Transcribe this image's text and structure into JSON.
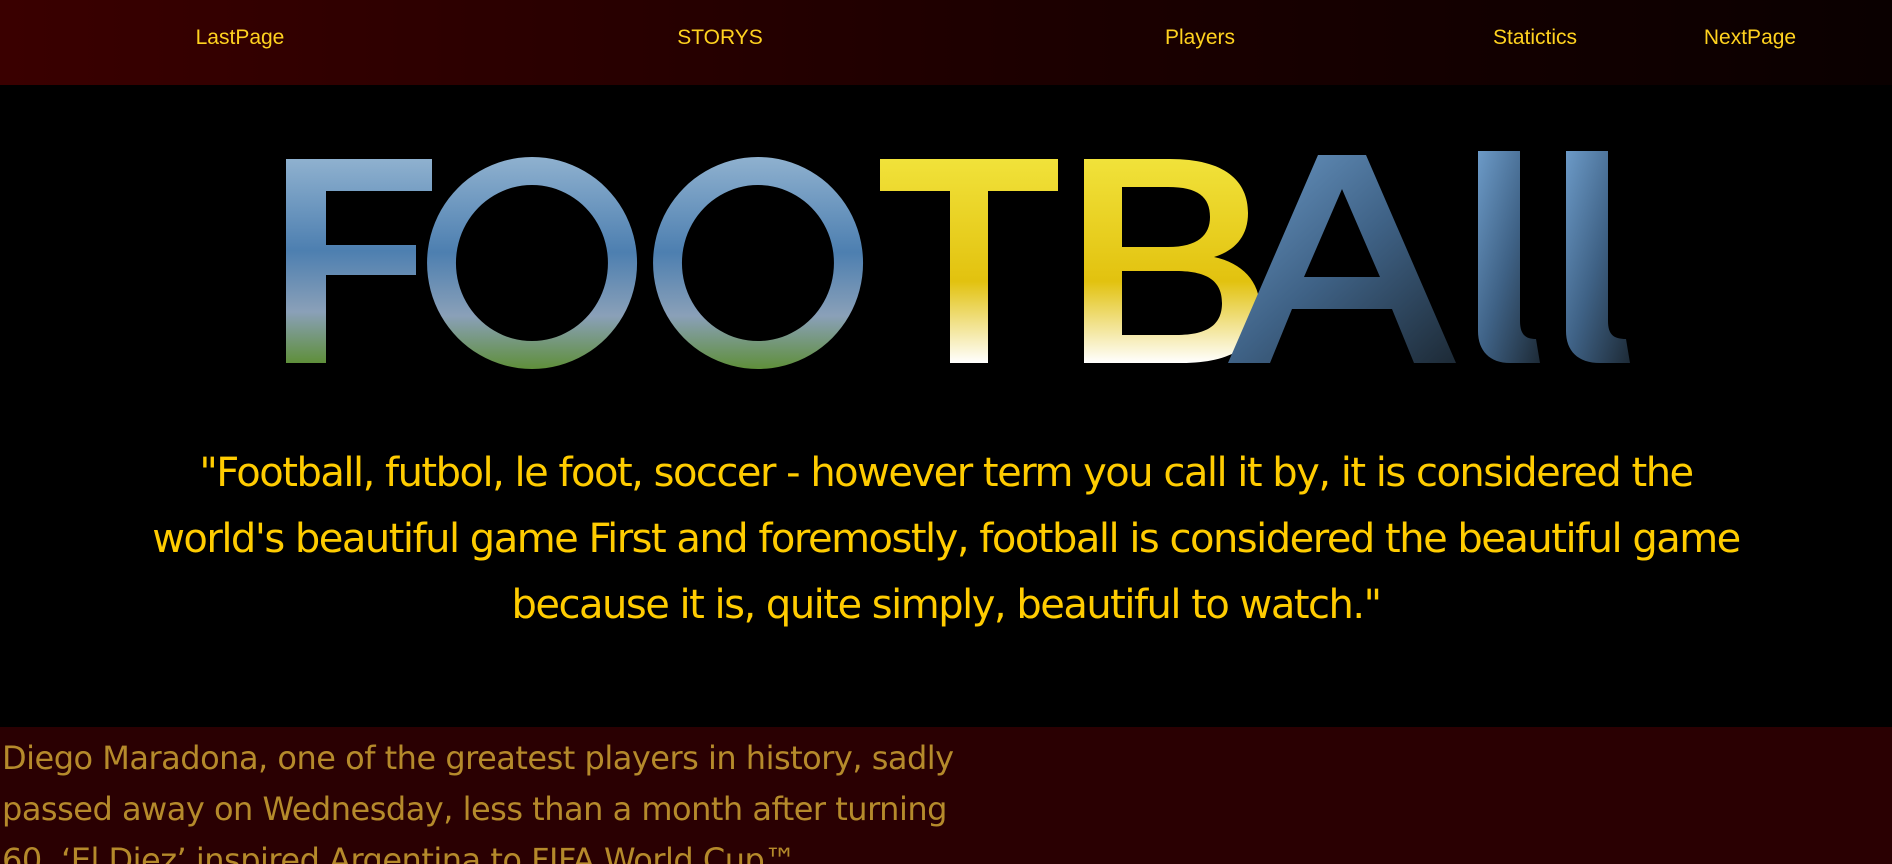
{
  "nav": {
    "items": [
      {
        "id": "last",
        "label": "LastPage"
      },
      {
        "id": "storys",
        "label": "STORYS"
      },
      {
        "id": "players",
        "label": "Players"
      },
      {
        "id": "stat",
        "label": "Statictics"
      },
      {
        "id": "next",
        "label": "NextPage"
      }
    ]
  },
  "hero": {
    "title": "FOOTBALL",
    "quote": "\"Football, futbol, le foot, soccer - however term you call it by, it is considered the world's beautiful game First and foremostly, football is considered the beautiful game because it is, quite simply, beautiful to watch.\""
  },
  "story": {
    "text": "Diego Maradona, one of the greatest players in history, sadly passed away on Wednesday, less than a month after turning 60. ‘El Diez’ inspired Argentina to FIFA World Cup™"
  },
  "colors": {
    "nav_text": "#ffd21f",
    "quote_text": "#ffcc00",
    "story_text": "#b58a2b",
    "story_bg": "#2a0002",
    "page_bg": "#000000"
  }
}
